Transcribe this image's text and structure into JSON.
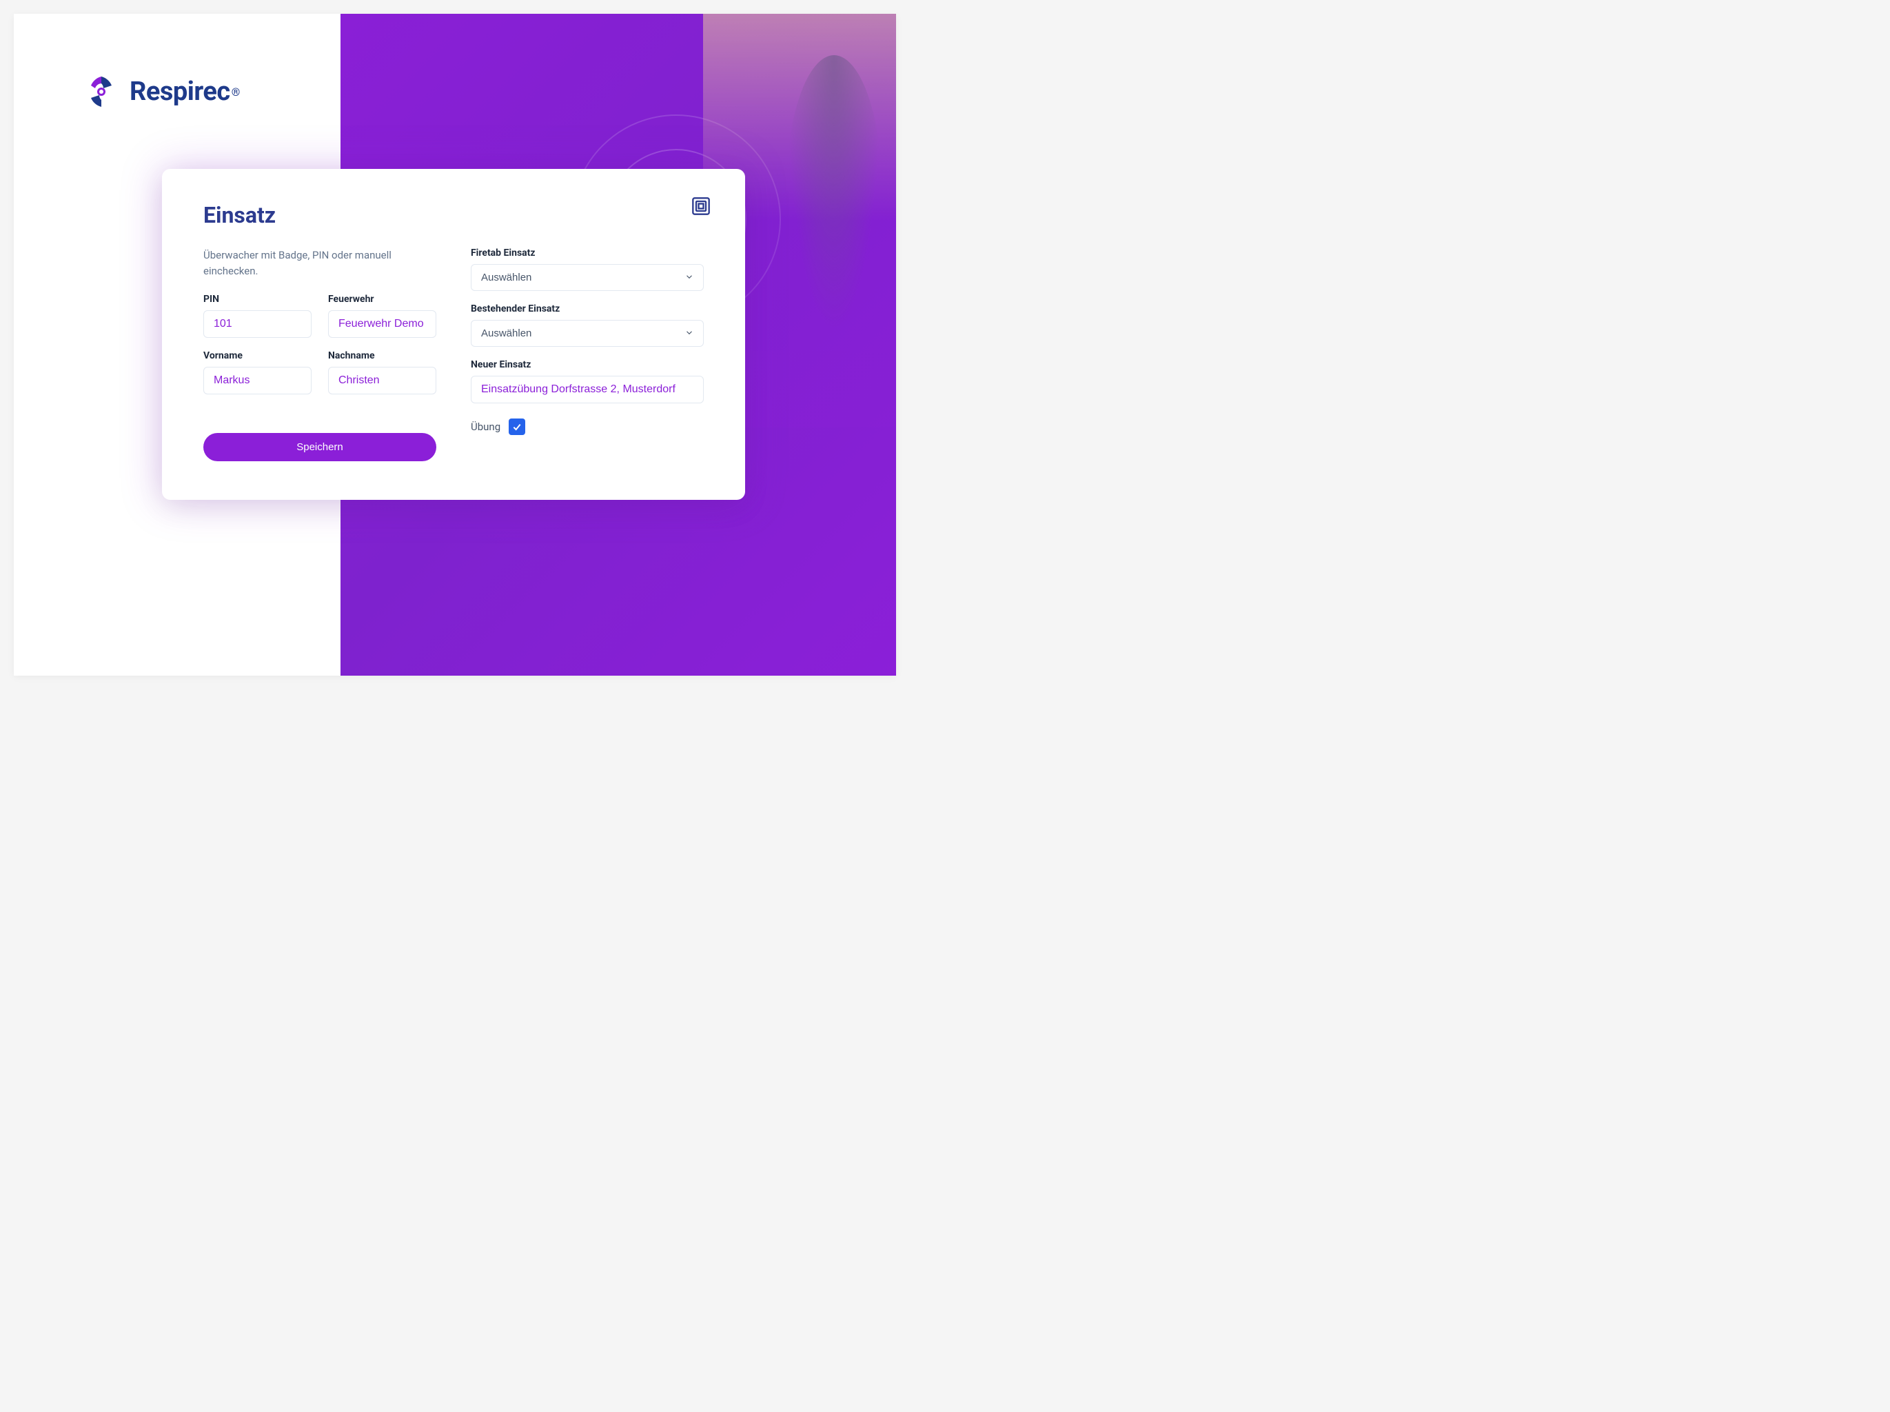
{
  "brand": {
    "name": "Respirec",
    "trademark": "®"
  },
  "card": {
    "title": "Einsatz",
    "description": "Überwacher mit Badge, PIN oder manuell einchecken."
  },
  "fields": {
    "pin": {
      "label": "PIN",
      "value": "101"
    },
    "feuerwehr": {
      "label": "Feuerwehr",
      "value": "Feuerwehr Demo"
    },
    "vorname": {
      "label": "Vorname",
      "value": "Markus"
    },
    "nachname": {
      "label": "Nachname",
      "value": "Christen"
    },
    "firetab_einsatz": {
      "label": "Firetab Einsatz",
      "selected": "Auswählen"
    },
    "bestehender_einsatz": {
      "label": "Bestehender Einsatz",
      "selected": "Auswählen"
    },
    "neuer_einsatz": {
      "label": "Neuer Einsatz",
      "value": "Einsatzübung Dorfstrasse 2, Musterdorf"
    },
    "uebung": {
      "label": "Übung",
      "checked": true
    }
  },
  "buttons": {
    "save": "Speichern"
  },
  "colors": {
    "primary": "#8b1fd8",
    "brand_navy": "#1e3a8a",
    "title_blue": "#2c3b8f",
    "checkbox_blue": "#2563eb"
  }
}
